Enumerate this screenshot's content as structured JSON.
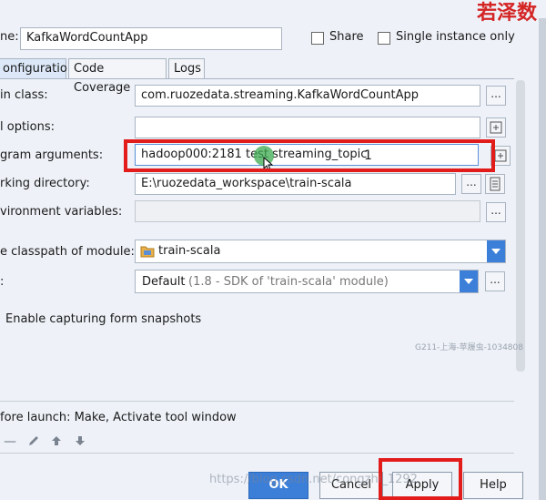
{
  "watermark_top": "若泽数",
  "name_row": {
    "label": "ne:",
    "value": "KafkaWordCountApp",
    "share_label": "Share",
    "single_instance_label": "Single instance only"
  },
  "tabs": [
    {
      "label": "onfiguration",
      "active": true
    },
    {
      "label": "Code Coverage",
      "active": false
    },
    {
      "label": "Logs",
      "active": false
    }
  ],
  "form": {
    "main_class": {
      "label": "in class:",
      "value": "com.ruozedata.streaming.KafkaWordCountApp",
      "button": "..."
    },
    "vm_options": {
      "label": "l options:",
      "value": ""
    },
    "program_args": {
      "label": "gram arguments:",
      "value": "hadoop000:2181 test streaming_topic",
      "annotation": "1"
    },
    "working_dir": {
      "label": "rking directory:",
      "value": "E:\\ruozedata_workspace\\train-scala",
      "button": "..."
    },
    "env_vars": {
      "label": "vironment variables:",
      "value": "",
      "button": "..."
    },
    "classpath": {
      "label": "e classpath of module:",
      "value": "train-scala"
    },
    "jre": {
      "label": ":",
      "value_main": "Default",
      "value_detail": "(1.8 - SDK of 'train-scala' module)",
      "button": "..."
    }
  },
  "snapshot_label": "Enable capturing form snapshots",
  "gray_watermark": "G211-上海-苹履虫-1034808",
  "before_launch": "fore launch: Make, Activate tool window",
  "footer_watermark": "https://blog.csdn.net/congzhi_1292",
  "buttons": {
    "ok": "OK",
    "cancel": "Cancel",
    "apply": "Apply",
    "help": "Help"
  },
  "colors": {
    "accent": "#3c7fd9",
    "highlight": "#e21b1b"
  }
}
